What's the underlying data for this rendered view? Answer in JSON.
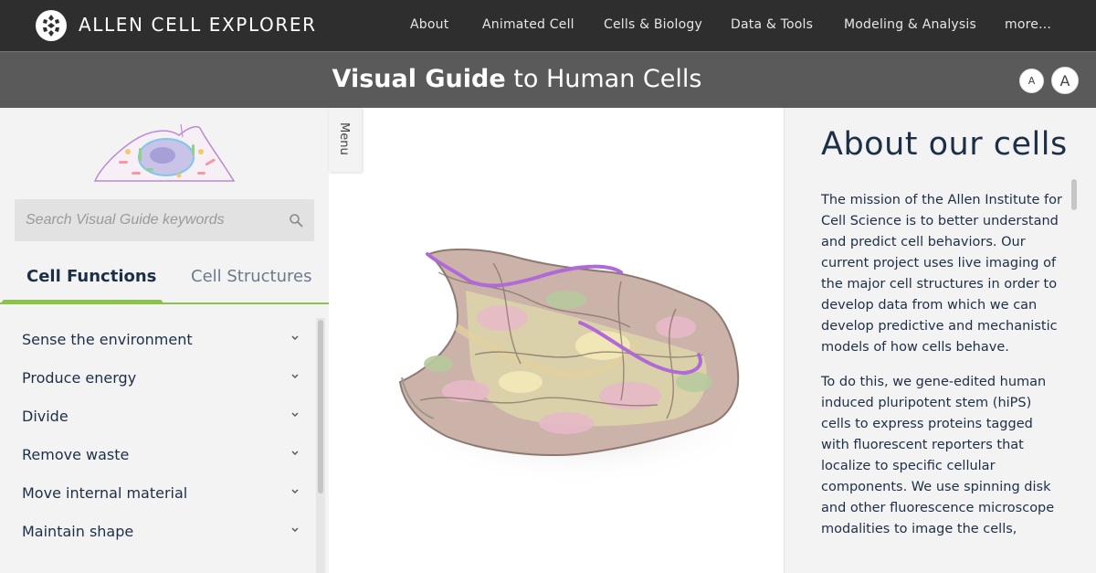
{
  "nav": {
    "brand": "ALLEN CELL EXPLORER",
    "links": [
      "About",
      "Animated Cell",
      "Cells & Biology",
      "Data & Tools",
      "Modeling & Analysis",
      "more..."
    ]
  },
  "titlebar": {
    "title_bold": "Visual Guide",
    "title_rest": " to Human Cells",
    "font_small_label": "A",
    "font_large_label": "A"
  },
  "sidebar": {
    "search_placeholder": "Search Visual Guide keywords",
    "tabs": {
      "active": "Cell Functions",
      "inactive": "Cell Structures"
    },
    "items": [
      "Sense the environment",
      "Produce energy",
      "Divide",
      "Remove waste",
      "Move internal material",
      "Maintain shape"
    ]
  },
  "center": {
    "menu_label": "Menu"
  },
  "about": {
    "heading": "About our cells",
    "p1": "The mission of the Allen Institute for Cell Science is to better understand and predict cell behaviors. Our current project uses live imaging of the major cell structures in order to develop data from which we can develop predictive and mechanistic models of how cells behave.",
    "p2": "To do this, we gene-edited human induced pluripotent stem (hiPS) cells to express proteins tagged with fluorescent reporters that localize to specific cellular components. We use spinning disk and other fluorescence microscope modalities to image the cells,"
  },
  "colors": {
    "accent_green": "#8bc34a",
    "navy": "#1d2f47",
    "nav_bg": "#2e2e2e",
    "title_bg": "#5a5a5a"
  },
  "icons": [
    "cell-logo-icon",
    "cell-illustration-icon",
    "search-icon",
    "chevron-down-icon"
  ]
}
